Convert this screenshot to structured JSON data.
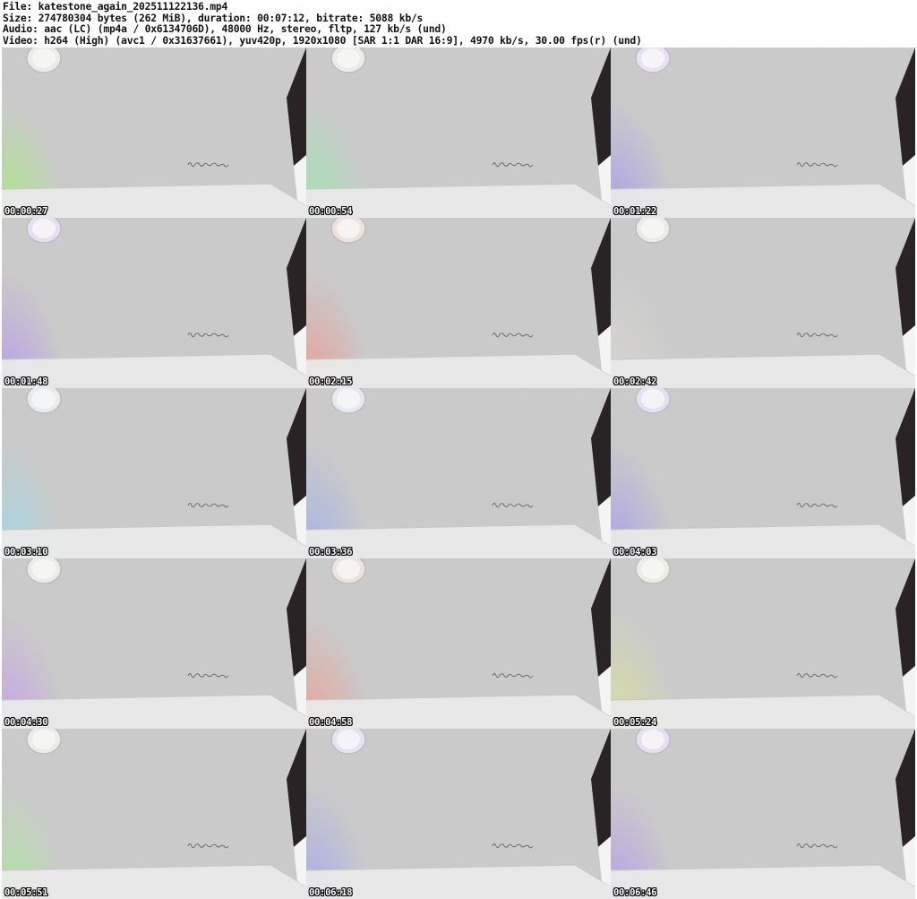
{
  "header": {
    "lines": [
      "File: katestone_again_202511122136.mp4",
      "Size: 274780304 bytes (262 MiB), duration: 00:07:12, bitrate: 5088 kb/s",
      "Audio: aac (LC) (mp4a / 0x6134706D), 48000 Hz, stereo, fltp, 127 kb/s (und)",
      "Video: h264 (High) (avc1 / 0x31637661), yuv420p, 1920x1080 [SAR 1:1 DAR 16:9], 4970 kb/s, 30.00 fps(r) (und)"
    ]
  },
  "colors": {
    "background": "#ffffff",
    "header_text": "#111111",
    "timestamp_text": "#ffffff",
    "timestamp_outline": "#000000"
  },
  "thumbnails": [
    {
      "time": "00:00:27",
      "tint": "#9cf26a",
      "ceiling_light": "#ecebe8"
    },
    {
      "time": "00:00:54",
      "tint": "#8ef0a6",
      "ceiling_light": "#ecebe8"
    },
    {
      "time": "00:01:22",
      "tint": "#9d8cf6",
      "ceiling_light": "#e7e0f6"
    },
    {
      "time": "00:01:48",
      "tint": "#b08af4",
      "ceiling_light": "#e6def2"
    },
    {
      "time": "00:02:15",
      "tint": "#f28c82",
      "ceiling_light": "#efe1dc"
    },
    {
      "time": "00:02:42",
      "tint": "#dcdad6",
      "ceiling_light": "#ecebe8"
    },
    {
      "time": "00:03:10",
      "tint": "#8fdcf2",
      "ceiling_light": "#e9ecee"
    },
    {
      "time": "00:03:36",
      "tint": "#93a8f2",
      "ceiling_light": "#e6e8f2"
    },
    {
      "time": "00:04:03",
      "tint": "#9c8ef7",
      "ceiling_light": "#e4def6"
    },
    {
      "time": "00:04:30",
      "tint": "#c493f1",
      "ceiling_light": "#ecebe8"
    },
    {
      "time": "00:04:58",
      "tint": "#f29584",
      "ceiling_light": "#ede2dc"
    },
    {
      "time": "00:05:24",
      "tint": "#dde88c",
      "ceiling_light": "#edeee2"
    },
    {
      "time": "00:05:51",
      "tint": "#a2ee8e",
      "ceiling_light": "#ecebe8"
    },
    {
      "time": "00:06:18",
      "tint": "#98a0f4",
      "ceiling_light": "#e3e3f3"
    },
    {
      "time": "00:06:46",
      "tint": "#b28df3",
      "ceiling_light": "#e6def4"
    }
  ]
}
